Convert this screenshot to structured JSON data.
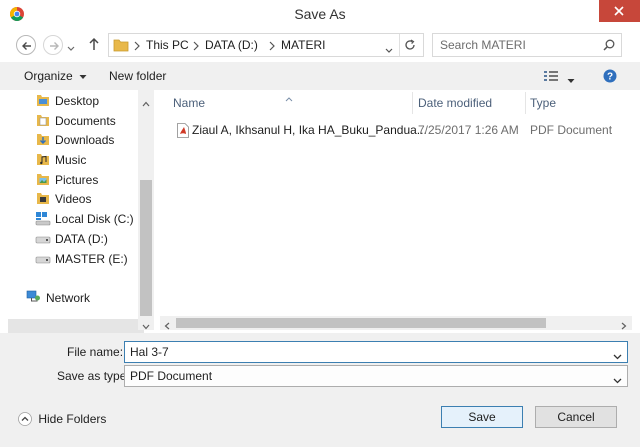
{
  "window": {
    "title": "Save As"
  },
  "address": {
    "crumbs": [
      "This PC",
      "DATA (D:)",
      "MATERI"
    ]
  },
  "search": {
    "placeholder": "Search MATERI"
  },
  "toolbar": {
    "organize": "Organize",
    "new_folder": "New folder"
  },
  "sidebar": {
    "items": [
      {
        "label": "Desktop",
        "icon": "desktop-folder-icon"
      },
      {
        "label": "Documents",
        "icon": "documents-folder-icon"
      },
      {
        "label": "Downloads",
        "icon": "downloads-folder-icon"
      },
      {
        "label": "Music",
        "icon": "music-folder-icon"
      },
      {
        "label": "Pictures",
        "icon": "pictures-folder-icon"
      },
      {
        "label": "Videos",
        "icon": "videos-folder-icon"
      },
      {
        "label": "Local Disk (C:)",
        "icon": "windows-drive-icon"
      },
      {
        "label": "DATA (D:)",
        "icon": "drive-icon"
      },
      {
        "label": "MASTER (E:)",
        "icon": "drive-icon"
      },
      {
        "label": "Network",
        "icon": "network-icon"
      }
    ],
    "selected": "DATA (D:)"
  },
  "file_list": {
    "columns": [
      "Name",
      "Date modified",
      "Type"
    ],
    "rows": [
      {
        "name": "Ziaul A, Ikhsanul H, Ika HA_Buku_Pandua...",
        "date": "7/25/2017 1:26 AM",
        "type": "PDF Document"
      }
    ]
  },
  "form": {
    "file_name_label": "File name:",
    "file_name_value": "Hal 3-7",
    "type_label": "Save as type:",
    "type_value": "PDF Document"
  },
  "footer": {
    "hide_folders": "Hide Folders",
    "save": "Save",
    "cancel": "Cancel"
  },
  "colors": {
    "close": "#c7473a",
    "selection": "#e5e5e5",
    "header_text": "#4c607a",
    "pdf": "#d03a27",
    "folder": "#e8b84a"
  }
}
